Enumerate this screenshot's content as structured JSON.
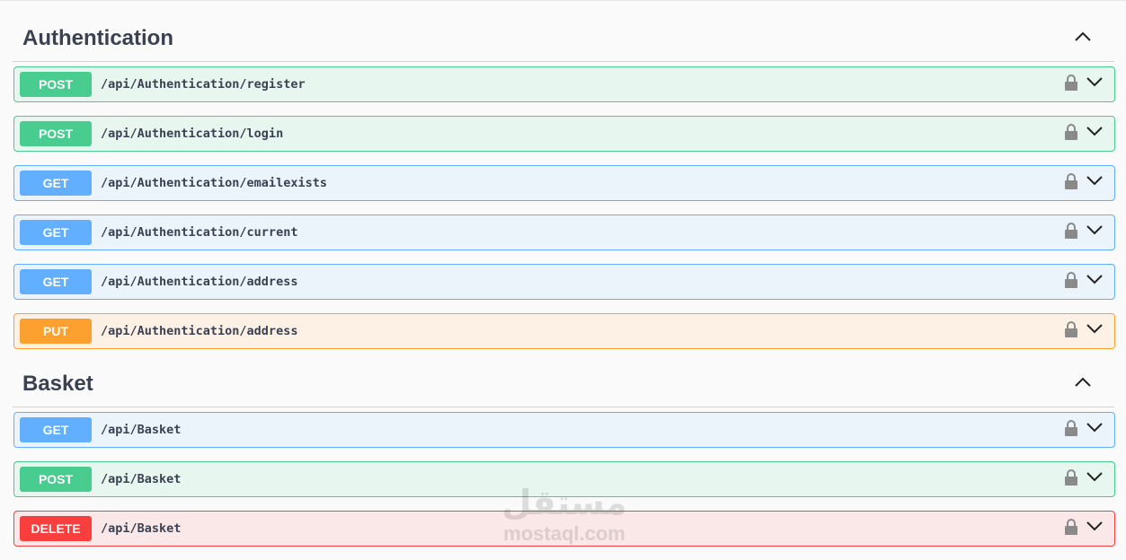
{
  "sections": [
    {
      "title": "Authentication",
      "operations": [
        {
          "method": "POST",
          "path": "/api/Authentication/register"
        },
        {
          "method": "POST",
          "path": "/api/Authentication/login"
        },
        {
          "method": "GET",
          "path": "/api/Authentication/emailexists"
        },
        {
          "method": "GET",
          "path": "/api/Authentication/current"
        },
        {
          "method": "GET",
          "path": "/api/Authentication/address"
        },
        {
          "method": "PUT",
          "path": "/api/Authentication/address"
        }
      ]
    },
    {
      "title": "Basket",
      "operations": [
        {
          "method": "GET",
          "path": "/api/Basket"
        },
        {
          "method": "POST",
          "path": "/api/Basket"
        },
        {
          "method": "DELETE",
          "path": "/api/Basket"
        }
      ]
    }
  ],
  "icons": {
    "collapse": "chevron-up-icon",
    "lock": "lock-icon",
    "expand": "chevron-down-icon"
  },
  "colors": {
    "post": "#49cc90",
    "get": "#61affe",
    "put": "#fca130",
    "delete": "#f93e3e"
  },
  "watermark": {
    "arabic": "مستقل",
    "latin": "mostaql.com"
  }
}
